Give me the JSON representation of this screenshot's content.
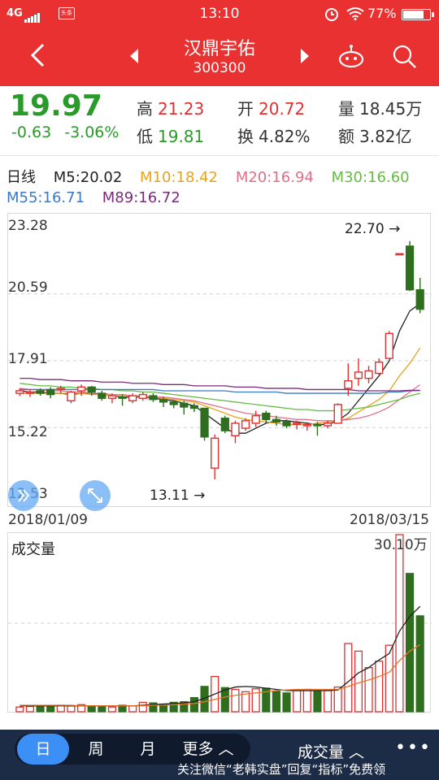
{
  "status_bar": {
    "network": "4G",
    "notification": "头条",
    "time": "13:10",
    "battery": "77%",
    "battery_level": 0.77
  },
  "nav": {
    "stock_name": "汉鼎宇佑",
    "stock_code": "300300"
  },
  "quote": {
    "price": "19.97",
    "change": "-0.63",
    "change_pct": "-3.06%",
    "high_label": "高",
    "high": "21.23",
    "low_label": "低",
    "low": "19.81",
    "open_label": "开",
    "open": "20.72",
    "turnover_label": "换",
    "turnover": "4.82%",
    "volume_label": "量",
    "volume": "18.45万",
    "amount_label": "额",
    "amount": "3.82亿"
  },
  "ma": {
    "period": "日线",
    "items": [
      {
        "label": "M5:20.02",
        "color": "#222222"
      },
      {
        "label": "M10:18.42",
        "color": "#e8a31c"
      },
      {
        "label": "M20:16.94",
        "color": "#e07088"
      },
      {
        "label": "M30:16.60",
        "color": "#66bb44"
      },
      {
        "label": "M55:16.71",
        "color": "#3a78c8"
      },
      {
        "label": "M89:16.72",
        "color": "#7a2a7a"
      }
    ]
  },
  "chart_data": {
    "type": "candlestick",
    "y_ticks": [
      "23.28",
      "20.59",
      "17.91",
      "15.22",
      "12.53"
    ],
    "ylim": [
      12.53,
      23.28
    ],
    "start_date": "2018/01/09",
    "end_date": "2018/03/15",
    "high_annotation": "22.70",
    "low_annotation": "13.11",
    "up_color": "#e03030",
    "down_color": "#2e6e1e",
    "candles": [
      [
        16.6,
        16.7,
        16.5,
        16.8
      ],
      [
        16.6,
        16.65,
        16.45,
        16.75
      ],
      [
        16.7,
        16.6,
        16.5,
        16.8
      ],
      [
        16.75,
        16.55,
        16.4,
        16.85
      ],
      [
        16.75,
        16.8,
        16.6,
        16.9
      ],
      [
        16.3,
        16.65,
        16.2,
        16.7
      ],
      [
        16.7,
        16.85,
        16.5,
        16.95
      ],
      [
        16.85,
        16.65,
        16.5,
        16.9
      ],
      [
        16.6,
        16.4,
        16.3,
        16.7
      ],
      [
        16.4,
        16.5,
        16.2,
        16.6
      ],
      [
        16.45,
        16.4,
        16.1,
        16.55
      ],
      [
        16.3,
        16.5,
        16.2,
        16.6
      ],
      [
        16.4,
        16.55,
        16.3,
        16.65
      ],
      [
        16.5,
        16.35,
        16.25,
        16.6
      ],
      [
        16.35,
        16.25,
        16.05,
        16.45
      ],
      [
        16.25,
        16.15,
        16.0,
        16.3
      ],
      [
        16.2,
        16.05,
        15.75,
        16.3
      ],
      [
        16.1,
        16.0,
        15.85,
        16.2
      ],
      [
        16.0,
        14.85,
        14.7,
        16.0
      ],
      [
        13.6,
        14.8,
        13.15,
        14.95
      ],
      [
        15.6,
        15.1,
        15.0,
        15.7
      ],
      [
        14.9,
        15.4,
        14.6,
        15.5
      ],
      [
        15.2,
        15.5,
        15.1,
        15.6
      ],
      [
        15.4,
        15.7,
        15.25,
        15.9
      ],
      [
        15.8,
        15.55,
        15.4,
        15.9
      ],
      [
        15.55,
        15.45,
        15.3,
        15.7
      ],
      [
        15.45,
        15.3,
        15.2,
        15.55
      ],
      [
        15.35,
        15.4,
        15.15,
        15.5
      ],
      [
        15.3,
        15.35,
        15.1,
        15.45
      ],
      [
        15.35,
        15.3,
        14.9,
        15.45
      ],
      [
        15.3,
        15.4,
        15.2,
        15.5
      ],
      [
        15.4,
        16.15,
        15.4,
        16.2
      ],
      [
        16.8,
        17.1,
        16.5,
        17.8
      ],
      [
        17.2,
        17.45,
        16.9,
        18.0
      ],
      [
        17.2,
        17.5,
        17.0,
        17.7
      ],
      [
        17.4,
        17.85,
        17.3,
        18.0
      ],
      [
        18.0,
        19.0,
        18.0,
        19.1
      ],
      [
        22.2,
        22.2,
        22.2,
        22.2
      ],
      [
        22.5,
        20.75,
        20.7,
        22.7
      ],
      [
        20.75,
        19.97,
        19.81,
        21.23
      ]
    ],
    "ma_lines": {
      "M5": [
        16.7,
        16.65,
        16.65,
        16.6,
        16.6,
        16.55,
        16.6,
        16.6,
        16.55,
        16.5,
        16.45,
        16.45,
        16.45,
        16.4,
        16.35,
        16.3,
        16.2,
        16.1,
        15.8,
        15.5,
        15.2,
        15.0,
        15.0,
        15.2,
        15.4,
        15.5,
        15.5,
        15.45,
        15.4,
        15.35,
        15.35,
        15.5,
        15.8,
        16.3,
        16.8,
        17.3,
        17.9,
        19.1,
        19.9,
        20.2
      ],
      "M10": [
        16.6,
        16.6,
        16.6,
        16.6,
        16.6,
        16.6,
        16.6,
        16.55,
        16.55,
        16.5,
        16.5,
        16.5,
        16.45,
        16.45,
        16.4,
        16.35,
        16.3,
        16.25,
        16.1,
        15.95,
        15.8,
        15.65,
        15.55,
        15.5,
        15.45,
        15.4,
        15.35,
        15.35,
        15.35,
        15.4,
        15.45,
        15.5,
        15.6,
        15.85,
        16.1,
        16.35,
        16.7,
        17.3,
        17.8,
        18.42
      ],
      "M20": [
        16.8,
        16.75,
        16.75,
        16.7,
        16.7,
        16.65,
        16.65,
        16.6,
        16.6,
        16.55,
        16.55,
        16.5,
        16.5,
        16.45,
        16.45,
        16.4,
        16.35,
        16.3,
        16.2,
        16.1,
        16.0,
        15.9,
        15.8,
        15.75,
        15.7,
        15.65,
        15.6,
        15.55,
        15.55,
        15.5,
        15.5,
        15.5,
        15.55,
        15.6,
        15.7,
        15.85,
        16.05,
        16.35,
        16.65,
        16.94
      ],
      "M30": [
        17.0,
        16.95,
        16.9,
        16.9,
        16.85,
        16.85,
        16.8,
        16.8,
        16.75,
        16.75,
        16.7,
        16.7,
        16.65,
        16.65,
        16.6,
        16.55,
        16.5,
        16.45,
        16.4,
        16.35,
        16.3,
        16.25,
        16.2,
        16.15,
        16.1,
        16.05,
        16.0,
        15.95,
        15.95,
        15.9,
        15.9,
        15.9,
        15.95,
        16.0,
        16.05,
        16.15,
        16.25,
        16.35,
        16.5,
        16.6
      ],
      "M55": [
        16.75,
        16.75,
        16.75,
        16.75,
        16.75,
        16.75,
        16.75,
        16.75,
        16.75,
        16.75,
        16.75,
        16.75,
        16.75,
        16.75,
        16.7,
        16.7,
        16.7,
        16.7,
        16.7,
        16.7,
        16.7,
        16.65,
        16.65,
        16.65,
        16.65,
        16.65,
        16.6,
        16.6,
        16.6,
        16.6,
        16.6,
        16.6,
        16.6,
        16.6,
        16.6,
        16.6,
        16.65,
        16.65,
        16.7,
        16.71
      ],
      "M89": [
        17.2,
        17.2,
        17.15,
        17.15,
        17.15,
        17.1,
        17.1,
        17.1,
        17.05,
        17.05,
        17.05,
        17.0,
        17.0,
        17.0,
        16.95,
        16.95,
        16.95,
        16.9,
        16.9,
        16.9,
        16.9,
        16.85,
        16.85,
        16.85,
        16.8,
        16.8,
        16.8,
        16.8,
        16.75,
        16.75,
        16.75,
        16.75,
        16.75,
        16.7,
        16.7,
        16.7,
        16.7,
        16.7,
        16.72,
        16.72
      ]
    },
    "volume_title": "成交量",
    "volume_max_label": "30.10万",
    "volume_max": 30.1,
    "volumes": [
      0.8,
      0.9,
      1.0,
      0.9,
      1.1,
      1.0,
      1.2,
      1.0,
      0.9,
      0.8,
      1.1,
      1.0,
      1.6,
      1.5,
      1.3,
      1.6,
      1.7,
      2.4,
      4.3,
      6.0,
      4.1,
      3.8,
      3.4,
      3.9,
      4.0,
      3.5,
      3.2,
      3.6,
      3.8,
      3.5,
      3.6,
      4.2,
      11.6,
      10.3,
      7.5,
      8.6,
      11.3,
      30.1,
      23.5,
      16.3
    ],
    "volume_ma": [
      1.0,
      1.0,
      1.0,
      1.0,
      1.0,
      1.0,
      1.0,
      1.0,
      1.0,
      1.0,
      1.0,
      1.0,
      1.1,
      1.2,
      1.3,
      1.4,
      1.5,
      1.7,
      2.3,
      3.0,
      3.7,
      4.2,
      4.3,
      4.2,
      4.0,
      3.8,
      3.6,
      3.6,
      3.6,
      3.6,
      3.6,
      3.7,
      5.1,
      6.6,
      7.5,
      8.8,
      9.9,
      13.7,
      16.2,
      17.9
    ],
    "volume_ma2": [
      1.1,
      1.1,
      1.1,
      1.1,
      1.1,
      1.1,
      1.0,
      1.0,
      1.0,
      1.0,
      1.0,
      1.0,
      1.0,
      1.1,
      1.1,
      1.2,
      1.3,
      1.4,
      1.7,
      2.1,
      2.5,
      2.8,
      3.0,
      3.2,
      3.4,
      3.6,
      3.7,
      3.8,
      3.8,
      3.8,
      3.8,
      3.8,
      4.3,
      4.9,
      5.4,
      6.0,
      6.7,
      8.7,
      10.3,
      11.4
    ]
  },
  "bottom_bar": {
    "tabs": [
      "日",
      "周",
      "月",
      "更多 ︿"
    ],
    "indicator": "成交量 ︿",
    "more": "•••",
    "footer_note": "关注微信“老韩实盘”回复“指标”免费领"
  }
}
